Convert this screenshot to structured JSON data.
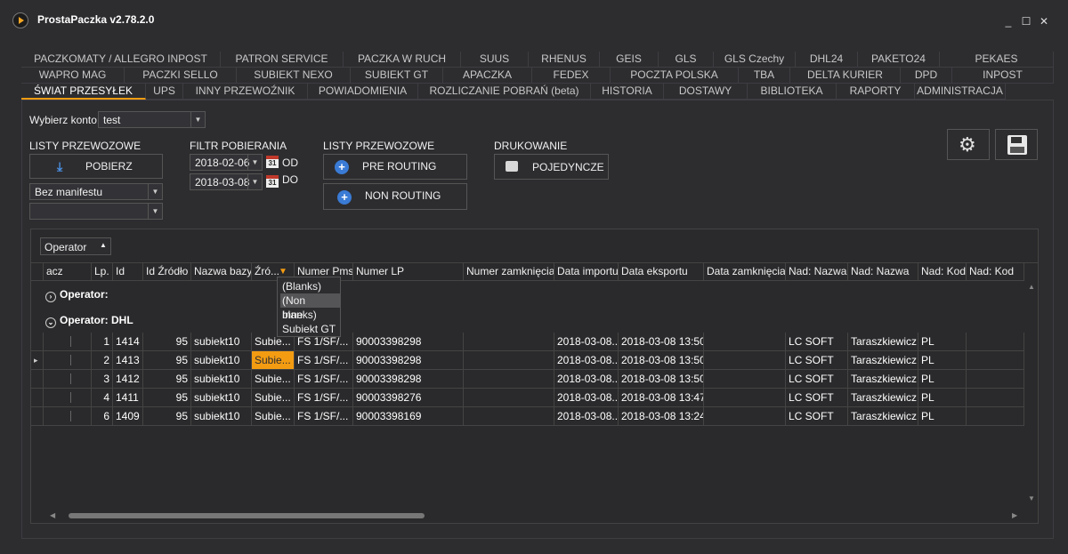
{
  "window": {
    "title": "ProstaPaczka v2.78.2.0",
    "minimize": "_",
    "maximize": "☐",
    "close": "✕"
  },
  "tabs": {
    "row1": [
      "PACZKOMATY / ALLEGRO INPOST",
      "PATRON SERVICE",
      "PACZKA W RUCH",
      "SUUS",
      "RHENUS",
      "GEIS",
      "GLS",
      "GLS Czechy",
      "DHL24",
      "PAKETO24",
      "PEKAES"
    ],
    "row2": [
      "WAPRO MAG",
      "PACZKI SELLO",
      "SUBIEKT NEXO",
      "SUBIEKT GT",
      "APACZKA",
      "FEDEX",
      "POCZTA POLSKA",
      "TBA",
      "DELTA KURIER",
      "DPD",
      "INPOST"
    ],
    "row3": [
      "ŚWIAT PRZESYŁEK",
      "UPS",
      "INNY PRZEWOŹNIK",
      "POWIADOMIENIA",
      "ROZLICZANIE POBRAŃ (beta)",
      "HISTORIA",
      "DOSTAWY",
      "BIBLIOTEKA",
      "RAPORTY",
      "ADMINISTRACJA"
    ],
    "active": "ŚWIAT PRZESYŁEK"
  },
  "account": {
    "label": "Wybierz konto:",
    "value": "test"
  },
  "sections": {
    "listy1": "LISTY PRZEWOZOWE",
    "filtr": "FILTR POBIERANIA",
    "listy2": "LISTY PRZEWOZOWE",
    "drukowanie": "DRUKOWANIE"
  },
  "buttons": {
    "pobierz": "POBIERZ",
    "pre_routing": "PRE ROUTING",
    "non_routing": "NON ROUTING",
    "pojedyncze": "POJEDYNCZE"
  },
  "manifest": {
    "value": "Bez manifestu",
    "second_value": ""
  },
  "filter": {
    "from_date": "2018-02-06",
    "from_label": "OD",
    "to_date": "2018-03-08",
    "to_label": "DO",
    "cal_day": "31"
  },
  "icons": {
    "settings": "gear-icon",
    "save": "floppy-disk-icon",
    "download": "download-arrow-icon",
    "plus": "plus-circle-icon",
    "print": "printer-icon",
    "calendar": "calendar-icon"
  },
  "grid": {
    "group_chip": "Operator",
    "columns": [
      "acz",
      "Lp.",
      "Id",
      "Id Źródło",
      "Nazwa bazy",
      "Źró...",
      "Numer Pms",
      "Numer LP",
      "Numer zamknięcia",
      "Data importu",
      "Data eksportu",
      "Data zamknięcia",
      "Nad: Nazwa",
      "Nad: Nazwa",
      "Nad: Kod",
      "Nad: Kod"
    ],
    "groups": [
      "Operator:",
      "Operator: DHL"
    ],
    "rows": [
      {
        "lp": "1",
        "id": "1414",
        "idzr": "95",
        "baza": "subiekt10",
        "zrodlo": "Subie...",
        "pms": "FS 1/SF/...",
        "lp_num": "90003398298",
        "zamk": "",
        "imp": "2018-03-08...",
        "eksp": "2018-03-08 13:50",
        "dzamk": "",
        "nad1": "LC SOFT",
        "nad2": "Taraszkiewicz",
        "kod1": "PL",
        "kod2": ""
      },
      {
        "lp": "2",
        "id": "1413",
        "idzr": "95",
        "baza": "subiekt10",
        "zrodlo": "Subie...",
        "pms": "FS 1/SF/...",
        "lp_num": "90003398298",
        "zamk": "",
        "imp": "2018-03-08...",
        "eksp": "2018-03-08 13:50",
        "dzamk": "",
        "nad1": "LC SOFT",
        "nad2": "Taraszkiewicz",
        "kod1": "PL",
        "kod2": ""
      },
      {
        "lp": "3",
        "id": "1412",
        "idzr": "95",
        "baza": "subiekt10",
        "zrodlo": "Subie...",
        "pms": "FS 1/SF/...",
        "lp_num": "90003398298",
        "zamk": "",
        "imp": "2018-03-08...",
        "eksp": "2018-03-08 13:50",
        "dzamk": "",
        "nad1": "LC SOFT",
        "nad2": "Taraszkiewicz",
        "kod1": "PL",
        "kod2": ""
      },
      {
        "lp": "4",
        "id": "1411",
        "idzr": "95",
        "baza": "subiekt10",
        "zrodlo": "Subie...",
        "pms": "FS 1/SF/...",
        "lp_num": "90003398276",
        "zamk": "",
        "imp": "2018-03-08...",
        "eksp": "2018-03-08 13:47",
        "dzamk": "",
        "nad1": "LC SOFT",
        "nad2": "Taraszkiewicz",
        "kod1": "PL",
        "kod2": ""
      },
      {
        "lp": "6",
        "id": "1409",
        "idzr": "95",
        "baza": "subiekt10",
        "zrodlo": "Subie...",
        "pms": "FS 1/SF/...",
        "lp_num": "90003398169",
        "zamk": "",
        "imp": "2018-03-08...",
        "eksp": "2018-03-08 13:24",
        "dzamk": "",
        "nad1": "LC SOFT",
        "nad2": "Taraszkiewicz",
        "kod1": "PL",
        "kod2": ""
      }
    ],
    "filter_popup": [
      "(Blanks)",
      "(Non blanks)",
      "Inne",
      "Subiekt GT"
    ],
    "filter_popup_highlight": "(Non blanks)",
    "selected_row": 1
  }
}
